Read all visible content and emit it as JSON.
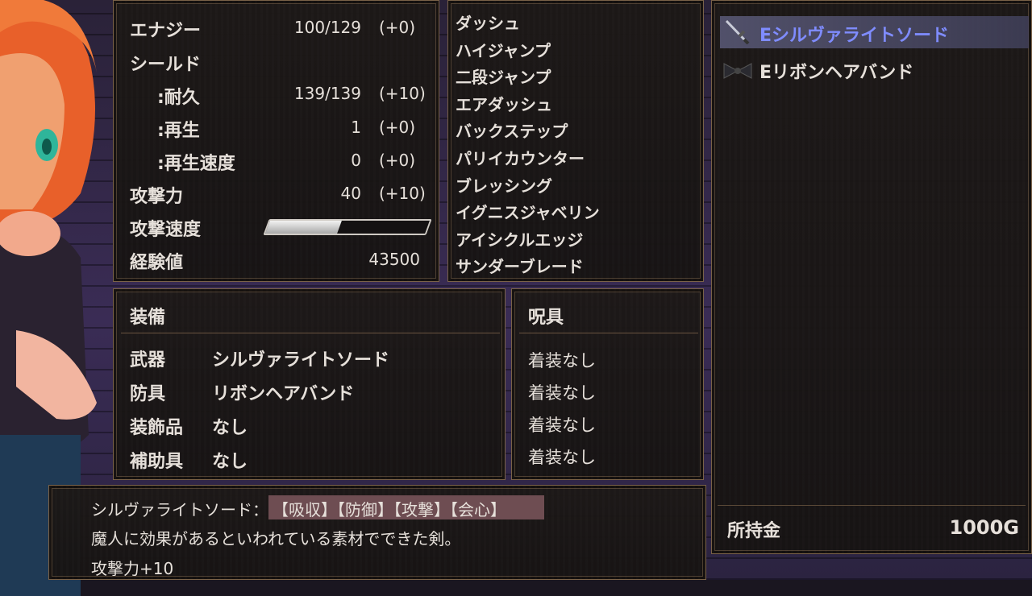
{
  "stats": {
    "energy_label": "エナジー",
    "energy_value": "100/129",
    "energy_bonus": "(+0)",
    "shield_label": "シールド",
    "durability_label": ":耐久",
    "durability_value": "139/139",
    "durability_bonus": "(+10)",
    "regen_label": ":再生",
    "regen_value": "1",
    "regen_bonus": "(+0)",
    "regen_speed_label": ":再生速度",
    "regen_speed_value": "0",
    "regen_speed_bonus": "(+0)",
    "attack_label": "攻撃力",
    "attack_value": "40",
    "attack_bonus": "(+10)",
    "attack_speed_label": "攻撃速度",
    "attack_speed_fraction": 0.45,
    "exp_label": "経験値",
    "exp_value": "43500"
  },
  "skills": [
    "ダッシュ",
    "ハイジャンプ",
    "二段ジャンプ",
    "エアダッシュ",
    "バックステップ",
    "パリイカウンター",
    "ブレッシング",
    "イグニスジャベリン",
    "アイシクルエッジ",
    "サンダーブレード"
  ],
  "equipment": {
    "title": "装備",
    "weapon_label": "武器",
    "weapon_value": "シルヴァライトソード",
    "armor_label": "防具",
    "armor_value": "リボンヘアバンド",
    "accessory_label": "装飾品",
    "accessory_value": "なし",
    "aux_label": "補助具",
    "aux_value": "なし"
  },
  "curses": {
    "title": "呪具",
    "slots": [
      "着装なし",
      "着装なし",
      "着装なし",
      "着装なし"
    ]
  },
  "inventory": {
    "items": [
      {
        "label": "Eシルヴァライトソード",
        "icon": "sword-icon",
        "selected": true
      },
      {
        "label": "Eリボンヘアバンド",
        "icon": "ribbon-icon",
        "selected": false
      }
    ],
    "money_label": "所持金",
    "money_value": "1000G"
  },
  "description": {
    "item_name": "シルヴァライトソード：",
    "tags": "【吸収】【防御】【攻撃】【会心】",
    "text": "魔人に効果があるといわれている素材でできた剣。",
    "effect": "攻撃力+10"
  },
  "colors": {
    "selected_text": "#7f8cff",
    "tag_bg": "#6e4d52",
    "frame": "#7a6248"
  }
}
